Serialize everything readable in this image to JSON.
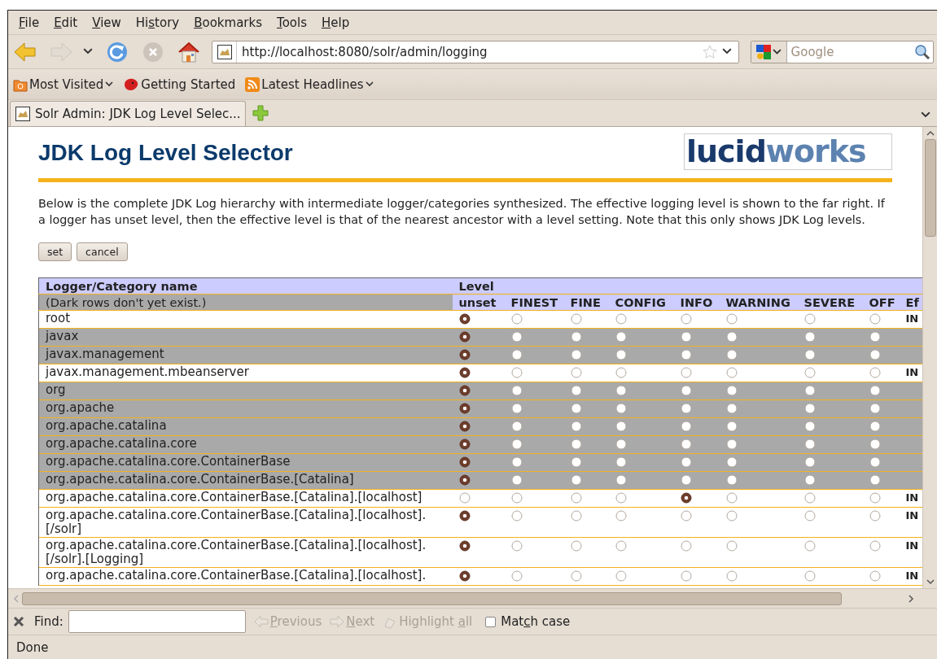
{
  "menu": [
    {
      "key": "F",
      "post": "ile"
    },
    {
      "key": "E",
      "post": "dit"
    },
    {
      "key": "V",
      "post": "iew"
    },
    {
      "pre": "Hi",
      "key": "s",
      "post": "tory"
    },
    {
      "key": "B",
      "post": "ookmarks"
    },
    {
      "key": "T",
      "post": "ools"
    },
    {
      "key": "H",
      "post": "elp"
    }
  ],
  "navigation": {
    "forward_disabled": true,
    "stop_disabled": true,
    "url": "http://localhost:8080/solr/admin/logging",
    "search_placeholder": "Google"
  },
  "bookmarks": [
    {
      "kind": "folder",
      "label": "Most Visited",
      "dropdown": true
    },
    {
      "kind": "tomato",
      "label": "Getting Started",
      "dropdown": false
    },
    {
      "kind": "feed",
      "label": "Latest Headlines",
      "dropdown": true
    }
  ],
  "tabs": [
    {
      "label": "Solr Admin: JDK Log Level Selec...",
      "selected": true
    }
  ],
  "page": {
    "title": "JDK Log Level Selector",
    "logo": {
      "first": "lucid",
      "second": "works"
    },
    "description": "Below is the complete JDK Log hierarchy with intermediate logger/categories synthesized. The effective logging level is shown to the far right. If a logger has unset level, then the effective level is that of the nearest ancestor with a level setting. Note that this only shows JDK Log levels.",
    "buttons": [
      "set",
      "cancel"
    ],
    "table": {
      "name_heading": "Logger/Category name",
      "level_heading": "Level",
      "note": "(Dark rows don't yet exist.)",
      "levels": [
        "unset",
        "FINEST",
        "FINE",
        "CONFIG",
        "INFO",
        "WARNING",
        "SEVERE",
        "OFF"
      ],
      "effective_heading": "Ef",
      "rows": [
        {
          "name": "root",
          "exists": true,
          "radios": [
            {
              "selected": true
            },
            {
              "selected": false
            },
            {
              "selected": false
            },
            {
              "selected": false
            },
            {
              "selected": false
            },
            {
              "selected": false
            },
            {
              "selected": false
            },
            {
              "selected": false
            }
          ],
          "effective": "IN"
        },
        {
          "name": "javax",
          "exists": false,
          "radios": [
            {
              "selected": true
            },
            {
              "selected": false
            },
            {
              "selected": false
            },
            {
              "selected": false
            },
            {
              "selected": false
            },
            {
              "selected": false
            },
            {
              "selected": false
            },
            {
              "selected": false
            }
          ]
        },
        {
          "name": "javax.management",
          "exists": false,
          "radios": [
            {
              "selected": true
            },
            {
              "selected": false
            },
            {
              "selected": false
            },
            {
              "selected": false
            },
            {
              "selected": false
            },
            {
              "selected": false
            },
            {
              "selected": false
            },
            {
              "selected": false
            }
          ]
        },
        {
          "name": "javax.management.mbeanserver",
          "exists": true,
          "radios": [
            {
              "selected": true
            },
            {
              "selected": false
            },
            {
              "selected": false
            },
            {
              "selected": false
            },
            {
              "selected": false
            },
            {
              "selected": false
            },
            {
              "selected": false
            },
            {
              "selected": false
            }
          ],
          "effective": "IN"
        },
        {
          "name": "org",
          "exists": false,
          "radios": [
            {
              "selected": true
            },
            {
              "selected": false
            },
            {
              "selected": false
            },
            {
              "selected": false
            },
            {
              "selected": false
            },
            {
              "selected": false
            },
            {
              "selected": false
            },
            {
              "selected": false
            }
          ]
        },
        {
          "name": "org.apache",
          "exists": false,
          "radios": [
            {
              "selected": true
            },
            {
              "selected": false
            },
            {
              "selected": false
            },
            {
              "selected": false
            },
            {
              "selected": false
            },
            {
              "selected": false
            },
            {
              "selected": false
            },
            {
              "selected": false
            }
          ]
        },
        {
          "name": "org.apache.catalina",
          "exists": false,
          "radios": [
            {
              "selected": true
            },
            {
              "selected": false
            },
            {
              "selected": false
            },
            {
              "selected": false
            },
            {
              "selected": false
            },
            {
              "selected": false
            },
            {
              "selected": false
            },
            {
              "selected": false
            }
          ]
        },
        {
          "name": "org.apache.catalina.core",
          "exists": false,
          "radios": [
            {
              "selected": true
            },
            {
              "selected": false
            },
            {
              "selected": false
            },
            {
              "selected": false
            },
            {
              "selected": false
            },
            {
              "selected": false
            },
            {
              "selected": false
            },
            {
              "selected": false
            }
          ]
        },
        {
          "name": "org.apache.catalina.core.ContainerBase",
          "exists": false,
          "radios": [
            {
              "selected": true
            },
            {
              "selected": false
            },
            {
              "selected": false
            },
            {
              "selected": false
            },
            {
              "selected": false
            },
            {
              "selected": false
            },
            {
              "selected": false
            },
            {
              "selected": false
            }
          ]
        },
        {
          "name": "org.apache.catalina.core.ContainerBase.[Catalina]",
          "exists": false,
          "radios": [
            {
              "selected": true
            },
            {
              "selected": false
            },
            {
              "selected": false
            },
            {
              "selected": false
            },
            {
              "selected": false
            },
            {
              "selected": false
            },
            {
              "selected": false
            },
            {
              "selected": false
            }
          ]
        },
        {
          "name": "org.apache.catalina.core.ContainerBase.[Catalina].[localhost]",
          "exists": true,
          "radios": [
            {
              "selected": false
            },
            {
              "selected": false
            },
            {
              "selected": false
            },
            {
              "selected": false
            },
            {
              "selected": true
            },
            {
              "selected": false
            },
            {
              "selected": false
            },
            {
              "selected": false
            }
          ],
          "effective": "IN"
        },
        {
          "name": "org.apache.catalina.core.ContainerBase.[Catalina].[localhost]. [/solr]",
          "exists": true,
          "radios": [
            {
              "selected": true
            },
            {
              "selected": false
            },
            {
              "selected": false
            },
            {
              "selected": false
            },
            {
              "selected": false
            },
            {
              "selected": false
            },
            {
              "selected": false
            },
            {
              "selected": false
            }
          ],
          "effective": "IN"
        },
        {
          "name": "org.apache.catalina.core.ContainerBase.[Catalina].[localhost]. [/solr].[Logging]",
          "exists": true,
          "radios": [
            {
              "selected": true
            },
            {
              "selected": false
            },
            {
              "selected": false
            },
            {
              "selected": false
            },
            {
              "selected": false
            },
            {
              "selected": false
            },
            {
              "selected": false
            },
            {
              "selected": false
            }
          ],
          "effective": "IN"
        },
        {
          "name": "org.apache.catalina.core.ContainerBase.[Catalina].[localhost].",
          "exists": true,
          "radios": [
            {
              "selected": true
            },
            {
              "selected": false
            },
            {
              "selected": false
            },
            {
              "selected": false
            },
            {
              "selected": false
            },
            {
              "selected": false
            },
            {
              "selected": false
            },
            {
              "selected": false
            }
          ],
          "effective": "IN"
        }
      ]
    }
  },
  "find_bar": {
    "label": "Find:",
    "actions": [
      {
        "kind": "previous",
        "key": "P",
        "post": "revious",
        "disabled": true
      },
      {
        "kind": "next",
        "key": "N",
        "post": "ext",
        "disabled": true
      },
      {
        "kind": "highlight",
        "pre": "Highlight ",
        "key": "a",
        "post": "ll",
        "disabled": true
      }
    ],
    "match_case": {
      "pre": "Mat",
      "key": "c",
      "post": "h case",
      "checked": false
    }
  },
  "status_bar": "Done"
}
